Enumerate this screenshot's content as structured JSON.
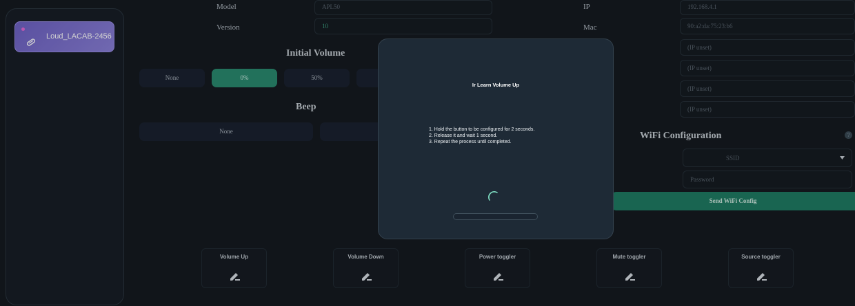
{
  "sidebar": {
    "device_name": "Loud_LACAB-2456",
    "status_color": "#e56ad6"
  },
  "info": {
    "model_label": "Model",
    "model_value": "APL50",
    "version_label": "Version",
    "version_value": "10",
    "ip_label": "IP",
    "ip_value": "192.168.4.1",
    "mac_label": "Mac",
    "mac_value": "90:a2:da:75:23:b6",
    "ip_unset": [
      "(IP unset)",
      "(IP unset)",
      "(IP unset)",
      "(IP unset)"
    ]
  },
  "initial_volume": {
    "title": "Initial Volume",
    "options": [
      "None",
      "0%",
      "50%"
    ],
    "selected": "0%"
  },
  "beep": {
    "title": "Beep",
    "options": [
      "None"
    ]
  },
  "wifi": {
    "title": "WiFi Configuration",
    "ssid_placeholder": "SSID",
    "password_placeholder": "Password",
    "send_label": "Send WiFi Config",
    "help_glyph": "?"
  },
  "ir_buttons": [
    {
      "label": "Volume Up",
      "icon": "pencil-icon"
    },
    {
      "label": "Volume Down",
      "icon": "pencil-icon"
    },
    {
      "label": "Power toggler",
      "icon": "pencil-icon"
    },
    {
      "label": "Mute toggler",
      "icon": "pencil-icon"
    },
    {
      "label": "Source toggler",
      "icon": "pencil-icon"
    }
  ],
  "modal": {
    "title": "Ir Learn Volume Up",
    "steps": [
      "1. Hold the button to be configured for 2 seconds.",
      "2. Release it and wait 1 second.",
      "3. Repeat the process until completed."
    ],
    "progress": 0
  },
  "colors": {
    "accent": "#2a8a70",
    "device_card": "#7a6fd0",
    "background": "#151a20"
  }
}
